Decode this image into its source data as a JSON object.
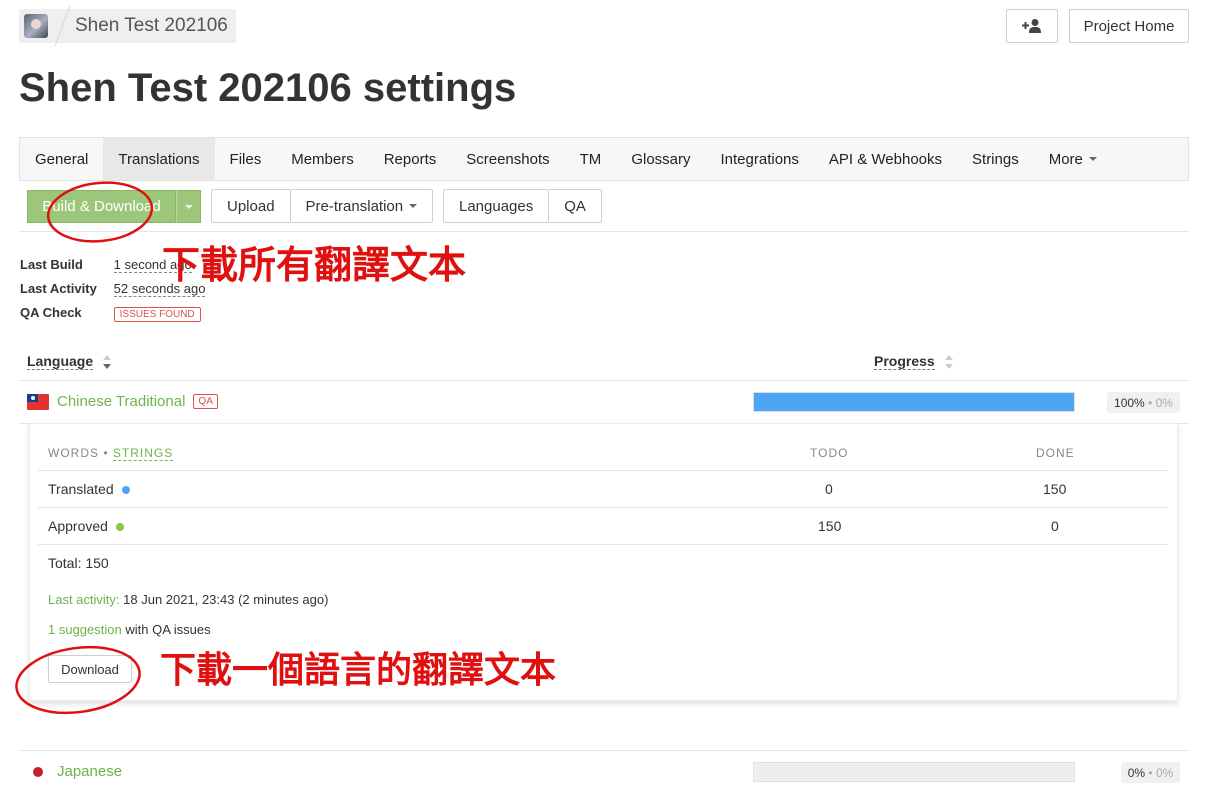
{
  "header": {
    "project_name": "Shen Test 202106",
    "avatar_icon": "user-avatar",
    "add_member_icon": "person-plus-icon",
    "project_home_label": "Project Home"
  },
  "page": {
    "title": "Shen Test 202106 settings"
  },
  "tabs": [
    {
      "label": "General",
      "active": false
    },
    {
      "label": "Translations",
      "active": true
    },
    {
      "label": "Files",
      "active": false
    },
    {
      "label": "Members",
      "active": false
    },
    {
      "label": "Reports",
      "active": false
    },
    {
      "label": "Screenshots",
      "active": false
    },
    {
      "label": "TM",
      "active": false
    },
    {
      "label": "Glossary",
      "active": false
    },
    {
      "label": "Integrations",
      "active": false
    },
    {
      "label": "API & Webhooks",
      "active": false
    },
    {
      "label": "Strings",
      "active": false
    },
    {
      "label": "More",
      "active": false
    }
  ],
  "actions": {
    "build_download": "Build & Download",
    "upload": "Upload",
    "pretranslation": "Pre-translation",
    "languages": "Languages",
    "qa": "QA"
  },
  "status": {
    "last_build_label": "Last Build",
    "last_build_value": "1 second ago",
    "last_activity_label": "Last Activity",
    "last_activity_value": "52 seconds ago",
    "qa_check_label": "QA Check",
    "qa_check_badge": "ISSUES FOUND"
  },
  "table": {
    "language_header": "Language",
    "progress_header": "Progress"
  },
  "languages": [
    {
      "name": "Chinese Traditional",
      "flag": "taiwan-flag",
      "qa_badge": "QA",
      "progress": 1.0,
      "translated_pct": "100%",
      "approved_pct": "0%",
      "separator": "•"
    },
    {
      "name": "Japanese",
      "flag": "japan-flag",
      "progress": 0.0,
      "translated_pct": "0%",
      "approved_pct": "0%",
      "separator": "•"
    }
  ],
  "detail": {
    "words_label": "WORDS",
    "separator": "•",
    "strings_label": "STRINGS",
    "todo_header": "TODO",
    "done_header": "DONE",
    "rows": [
      {
        "label": "Translated",
        "todo": "0",
        "done": "150",
        "dot_color": "#4da6f5"
      },
      {
        "label": "Approved",
        "todo": "150",
        "done": "0",
        "dot_color": "#8cc63f"
      }
    ],
    "total": "Total: 150",
    "last_activity_label": "Last activity:",
    "last_activity_value": "18 Jun 2021, 23:43 (2 minutes ago)",
    "suggestion_link": "1 suggestion",
    "suggestion_text": "with QA issues",
    "download_label": "Download"
  },
  "annotations": {
    "note_build": "下載所有翻譯文本",
    "note_download": "下載一個語言的翻譯文本",
    "color": "#e01010"
  }
}
